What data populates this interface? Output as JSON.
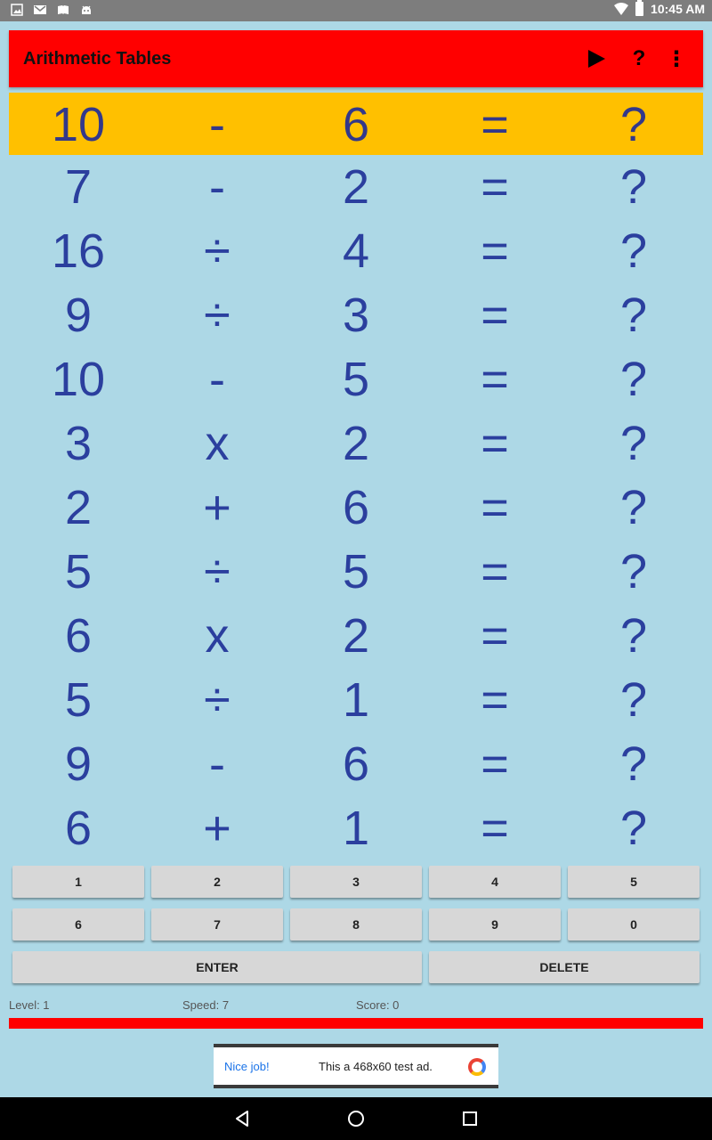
{
  "status_bar": {
    "time": "10:45 AM",
    "left_icons": [
      "image-icon",
      "gmail-icon",
      "book-icon",
      "android-icon"
    ],
    "right_icons": [
      "wifi-icon",
      "battery-icon"
    ]
  },
  "app_bar": {
    "title": "Arithmetic Tables",
    "actions": [
      "play-icon",
      "help-icon",
      "overflow-menu-icon"
    ],
    "help_label": "?",
    "menu_label": "⋮",
    "color": "#ff0000"
  },
  "problems": [
    {
      "a": "10",
      "op": "-",
      "b": "6",
      "eq": "=",
      "ans": "?",
      "active": true
    },
    {
      "a": "7",
      "op": "-",
      "b": "2",
      "eq": "=",
      "ans": "?"
    },
    {
      "a": "16",
      "op": "÷",
      "b": "4",
      "eq": "=",
      "ans": "?"
    },
    {
      "a": "9",
      "op": "÷",
      "b": "3",
      "eq": "=",
      "ans": "?"
    },
    {
      "a": "10",
      "op": "-",
      "b": "5",
      "eq": "=",
      "ans": "?"
    },
    {
      "a": "3",
      "op": "x",
      "b": "2",
      "eq": "=",
      "ans": "?"
    },
    {
      "a": "2",
      "op": "+",
      "b": "6",
      "eq": "=",
      "ans": "?"
    },
    {
      "a": "5",
      "op": "÷",
      "b": "5",
      "eq": "=",
      "ans": "?"
    },
    {
      "a": "6",
      "op": "x",
      "b": "2",
      "eq": "=",
      "ans": "?"
    },
    {
      "a": "5",
      "op": "÷",
      "b": "1",
      "eq": "=",
      "ans": "?"
    },
    {
      "a": "9",
      "op": "-",
      "b": "6",
      "eq": "=",
      "ans": "?"
    },
    {
      "a": "6",
      "op": "+",
      "b": "1",
      "eq": "=",
      "ans": "?"
    }
  ],
  "keypad": {
    "row1": [
      "1",
      "2",
      "3",
      "4",
      "5"
    ],
    "row2": [
      "6",
      "7",
      "8",
      "9",
      "0"
    ],
    "enter": "ENTER",
    "delete": "DELETE"
  },
  "stats": {
    "level": "Level: 1",
    "speed": "Speed: 7",
    "score": "Score: 0"
  },
  "ad": {
    "nice": "Nice job!",
    "text": "This a 468x60 test ad."
  },
  "colors": {
    "background": "#add8e6",
    "active_row": "#ffc000",
    "text": "#2b3f9e",
    "timer_bar": "#ff0000"
  }
}
